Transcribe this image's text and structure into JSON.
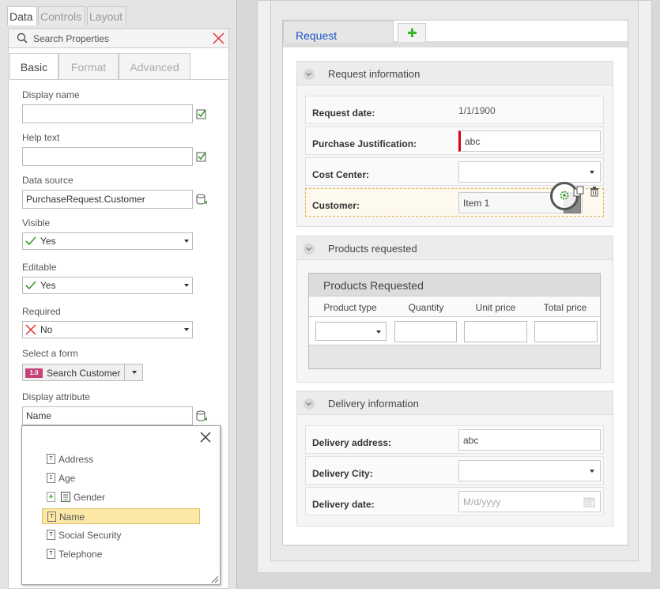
{
  "top_tabs": [
    {
      "label": "Data"
    },
    {
      "label": "Controls"
    },
    {
      "label": "Layout"
    }
  ],
  "search": {
    "placeholder": "Search Properties"
  },
  "sub_tabs": [
    {
      "label": "Basic"
    },
    {
      "label": "Format"
    },
    {
      "label": "Advanced"
    }
  ],
  "fields": {
    "display_name": {
      "label": "Display name",
      "value": ""
    },
    "help_text": {
      "label": "Help text",
      "value": ""
    },
    "data_source": {
      "label": "Data source",
      "value": "PurchaseRequest.Customer"
    },
    "visible": {
      "label": "Visible",
      "value": "Yes"
    },
    "editable": {
      "label": "Editable",
      "value": "Yes"
    },
    "required": {
      "label": "Required",
      "value": "No"
    },
    "select_form": {
      "label": "Select a form",
      "badge": "1.0",
      "value": "Search Customer"
    },
    "display_attribute": {
      "label": "Display attribute",
      "value": "Name"
    }
  },
  "attributes": [
    {
      "label": "Address",
      "icon": "T"
    },
    {
      "label": "Age",
      "icon": "1"
    },
    {
      "label": "Gender",
      "icon": "+"
    },
    {
      "label": "Name",
      "icon": "T",
      "selected": true
    },
    {
      "label": "Social Security",
      "icon": "T"
    },
    {
      "label": "Telephone",
      "icon": "T"
    }
  ],
  "form": {
    "tab": "Request",
    "sections": {
      "request_info": {
        "title": "Request information",
        "request_date": {
          "label": "Request date:",
          "value": "1/1/1900"
        },
        "justification": {
          "label": "Purchase Justification:",
          "value": "abc"
        },
        "cost_center": {
          "label": "Cost Center:",
          "value": ""
        },
        "customer": {
          "label": "Customer:",
          "value": "Item 1"
        }
      },
      "products": {
        "title": "Products requested",
        "grid_title": "Products Requested",
        "columns": [
          "Product type",
          "Quantity",
          "Unit price",
          "Total price"
        ]
      },
      "delivery": {
        "title": "Delivery information",
        "address": {
          "label": "Delivery address:",
          "value": "abc"
        },
        "city": {
          "label": "Delivery City:",
          "value": ""
        },
        "date": {
          "label": "Delivery date:",
          "placeholder": "M/d/yyyy"
        }
      }
    }
  },
  "colors": {
    "accent_blue": "#1a55c8",
    "required_red": "#d9001b",
    "selected_yellow": "#fbe7a6",
    "check_green": "#3a9a2a",
    "x_red": "#d33"
  }
}
